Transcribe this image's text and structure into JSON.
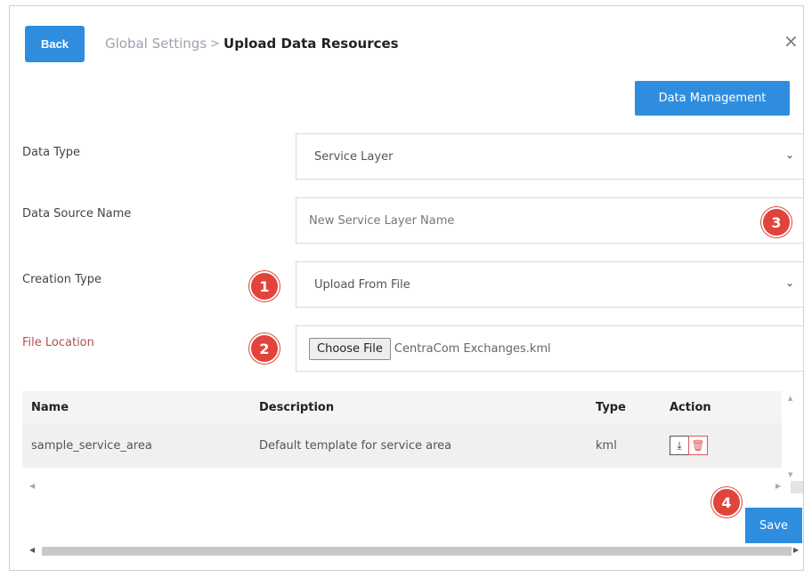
{
  "header": {
    "back_label": "Back",
    "breadcrumb_root": "Global Settings",
    "breadcrumb_sep": ">",
    "breadcrumb_current": "Upload Data Resources",
    "close_glyph": "×"
  },
  "data_management_label": "Data Management",
  "form": {
    "data_type_label": "Data Type",
    "data_type_value": "Service Layer",
    "source_name_label": "Data Source Name",
    "source_name_placeholder": "New Service Layer Name",
    "creation_type_label": "Creation Type",
    "creation_type_value": "Upload From File",
    "file_location_label": "File Location",
    "choose_file_label": "Choose File",
    "file_name": "CentraCom Exchanges.kml"
  },
  "table": {
    "headers": [
      "Name",
      "Description",
      "Type",
      "Action"
    ],
    "rows": [
      {
        "name": "sample_service_area",
        "description": "Default template for service area",
        "type": "kml"
      }
    ]
  },
  "icons": {
    "download": "download-icon",
    "delete": "trash-icon",
    "chevron": "chevron-down-icon",
    "close": "close-icon"
  },
  "save_label": "Save",
  "badges": [
    "1",
    "2",
    "3",
    "4"
  ],
  "colors": {
    "primary": "#2f8de0",
    "badge": "#e0443a",
    "delete": "#dd5555"
  }
}
